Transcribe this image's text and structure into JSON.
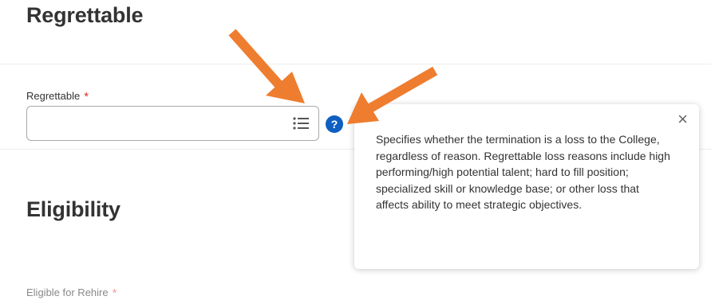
{
  "sections": {
    "regrettable_title": "Regrettable",
    "eligibility_title": "Eligibility"
  },
  "regrettable_field": {
    "label": "Regrettable",
    "required_marker": "*",
    "value": "",
    "icon": "list-icon"
  },
  "help": {
    "icon_label": "?",
    "close_label": "×",
    "text": "Specifies whether the termination is a loss to the College, regardless of reason. Regrettable loss reasons include high performing/high potential talent; hard to fill position; specialized skill or knowledge base; or other loss that affects ability to meet strategic objectives."
  },
  "rehire_field": {
    "label": "Eligible for Rehire",
    "required_marker": "*"
  },
  "annotations": {
    "arrow_color": "#ee7d2f",
    "arrow_count": 2
  }
}
